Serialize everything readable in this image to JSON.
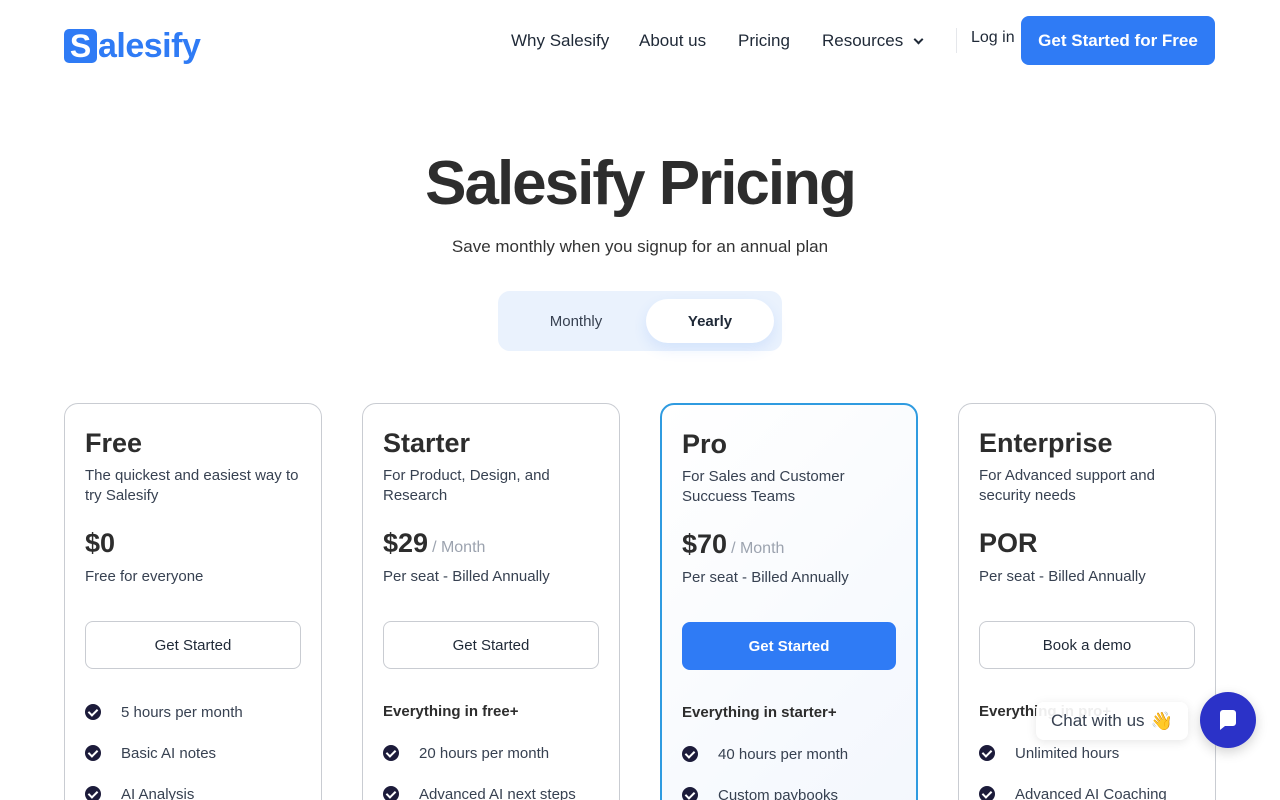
{
  "brand": {
    "logo_letter": "S",
    "logo_rest": "alesify",
    "color": "#2f7bf5"
  },
  "nav": {
    "items": [
      "Why Salesify",
      "About us",
      "Pricing",
      "Resources"
    ],
    "login": "Log in",
    "cta": "Get Started for Free"
  },
  "hero": {
    "title": "Salesify Pricing",
    "subtitle": "Save monthly when you signup for an annual  plan"
  },
  "billing_toggle": {
    "options": [
      "Monthly",
      "Yearly"
    ],
    "selected": "Yearly"
  },
  "plans": [
    {
      "name": "Free",
      "description": "The quickest and easiest way to try Salesify",
      "price": "$0",
      "price_period": "",
      "billing": "Free for everyone",
      "button": "Get Started",
      "heading": "",
      "features": [
        "5 hours per month",
        "Basic AI notes",
        "AI Analysis"
      ]
    },
    {
      "name": "Starter",
      "description": "For Product, Design, and Research",
      "price": "$29",
      "price_period": "/ Month",
      "billing": "Per seat - Billed Annually",
      "button": "Get Started",
      "heading": "Everything in free+",
      "features": [
        "20 hours per month",
        "Advanced AI next steps"
      ]
    },
    {
      "name": "Pro",
      "description": "For Sales and Customer Succuess Teams",
      "price": "$70",
      "price_period": "/ Month",
      "billing": "Per seat - Billed Annually",
      "button": "Get Started",
      "heading": "Everything in starter+",
      "features": [
        "40 hours per month",
        "Custom paybooks"
      ]
    },
    {
      "name": "Enterprise",
      "description": "For Advanced support and security needs",
      "price": "POR",
      "price_period": "",
      "billing": "Per seat - Billed Annually",
      "button": "Book a demo",
      "heading": "Everything in pro+",
      "features": [
        "Unlimited hours",
        "Advanced AI Coaching"
      ]
    }
  ],
  "chat": {
    "label": "Chat with us",
    "emoji": "👋",
    "button_color": "#2b32c8"
  }
}
